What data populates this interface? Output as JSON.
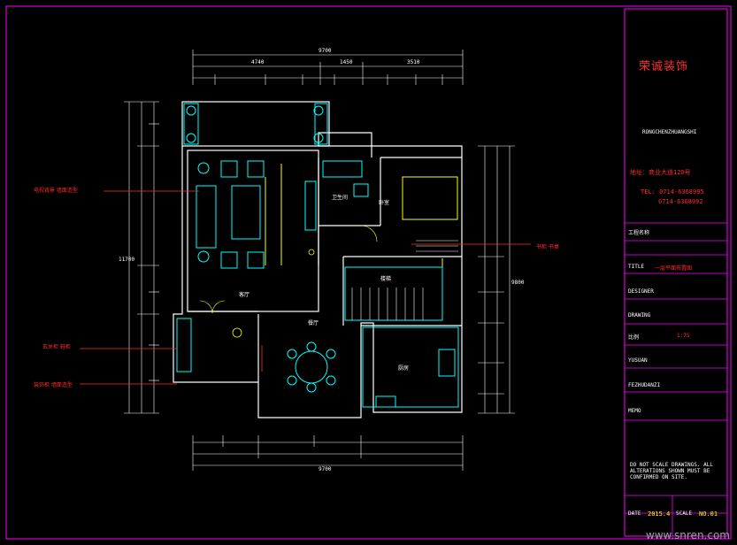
{
  "title_block": {
    "company": "荣诚装饰",
    "pinyin": "RONGCHENZHUANGSHI",
    "address": "地址：商业大道120号",
    "tel1": "TEL: 0714-6368995",
    "tel2": "0714-6368992",
    "project_label": "工程名称",
    "drawing_title_cn": "一层平面布置图",
    "title_label": "TITLE",
    "design_label": "DESIGNER",
    "drawing_label": "DRAWING",
    "scale_label": "比例",
    "scale_value": "1:75",
    "yusuan": "YUSUAN",
    "fezhu": "FEZHUDANZI",
    "memo": "MEMO",
    "notes_en": "DO NOT SCALE DRAWINGS. ALL ALTERATIONS SHOWN MUST BE CONFIRMED ON SITE.",
    "date_label": "DATE",
    "date_value": "2015.4",
    "scale_label2": "SCALE",
    "no_value": "NO.01"
  },
  "annotations": {
    "left1": "电视背景 墙面造型",
    "left2": "玄关柜 鞋柜",
    "left3": "装饰柜 墙面造型",
    "right1": "书柜 书桌",
    "rooms": {
      "living": "客厅",
      "dining": "餐厅",
      "kitchen": "厨房",
      "bath": "卫生间",
      "bedroom": "卧室",
      "stair": "楼梯"
    }
  },
  "dimensions": {
    "top_total": "9700",
    "top_segments": [
      "4740",
      "1450",
      "3510"
    ],
    "bottom_total": "9700",
    "left_total": "11700",
    "right_total": "9800"
  },
  "watermark": "www.snren.com",
  "colors": {
    "magenta": "#ff00ff",
    "white": "#ffffff",
    "cyan": "#00ffff",
    "red": "#ff2a2a",
    "yellow": "#ffff00"
  }
}
